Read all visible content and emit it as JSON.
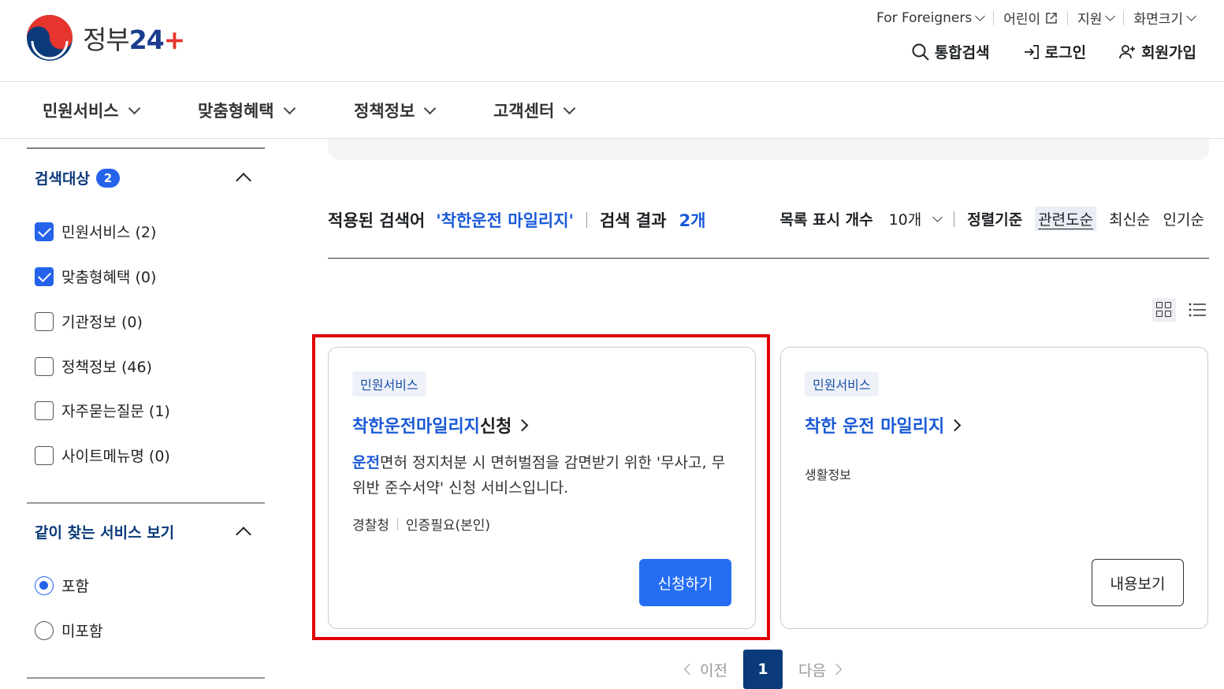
{
  "header": {
    "logo_text": "정부",
    "logo_num": "24",
    "utility": [
      "For Foreigners",
      "어린이",
      "지원",
      "화면크기"
    ],
    "actions": [
      "통합검색",
      "로그인",
      "회원가입"
    ]
  },
  "gnb": [
    "민원서비스",
    "맞춤형혜택",
    "정책정보",
    "고객센터"
  ],
  "sidebar": {
    "filter_title": "검색대상",
    "filter_count": "2",
    "options": [
      {
        "label": "민원서비스 (2)",
        "checked": true
      },
      {
        "label": "맞춤형혜택 (0)",
        "checked": true
      },
      {
        "label": "기관정보 (0)",
        "checked": false
      },
      {
        "label": "정책정보 (46)",
        "checked": false
      },
      {
        "label": "자주묻는질문 (1)",
        "checked": false
      },
      {
        "label": "사이트메뉴명 (0)",
        "checked": false
      }
    ],
    "related_title": "같이 찾는 서비스 보기",
    "radios": [
      {
        "label": "포함",
        "selected": true
      },
      {
        "label": "미포함",
        "selected": false
      }
    ]
  },
  "results": {
    "applied_label": "적용된 검색어",
    "keyword": "'착한운전 마일리지'",
    "result_label": "검색 결과",
    "result_count": "2개",
    "per_page_label": "목록 표시 개수",
    "per_page_value": "10개",
    "sort_label": "정렬기준",
    "sort_options": [
      "관련도순",
      "최신순",
      "인기순"
    ]
  },
  "cards": [
    {
      "tag": "민원서비스",
      "title_hl": "착한운전마일리지",
      "title_rest": "신청",
      "desc_hl": "운전",
      "desc_rest": "면허 정지처분 시 면허벌점을 감면받기 위한 '무사고, 무위반 준수서약' 신청 서비스입니다.",
      "meta": [
        "경찰청",
        "인증필요(본인)"
      ],
      "button": "신청하기"
    },
    {
      "tag": "민원서비스",
      "title_hl": "착한 운전 마일리지",
      "title_rest": "",
      "desc": "생활정보",
      "button": "내용보기"
    }
  ],
  "pager": {
    "prev": "이전",
    "current": "1",
    "next": "다음"
  },
  "colors": {
    "primary": "#256ef4",
    "navy": "#0b3a7a",
    "highlight": "#e10000"
  }
}
